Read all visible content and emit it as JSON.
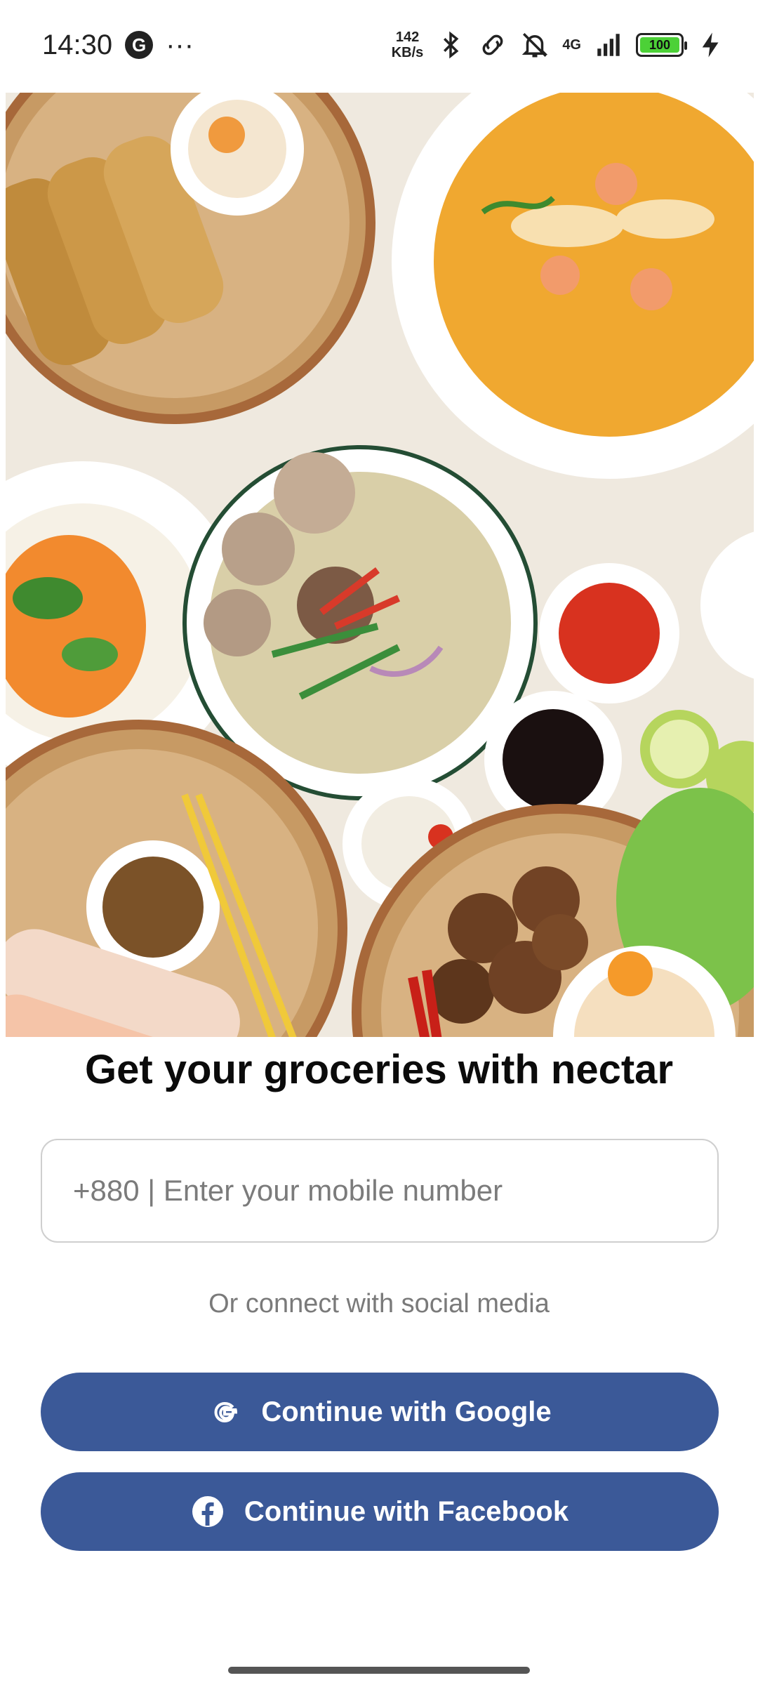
{
  "status_bar": {
    "time": "14:30",
    "g_icon": "G",
    "more": "···",
    "speed_value": "142",
    "speed_unit": "KB/s",
    "network": "4G",
    "battery": "100"
  },
  "hero": {
    "image": "vietnamese-food-spread"
  },
  "headline": "Get your groceries with nectar",
  "phone_input": {
    "placeholder": "+880 | Enter your mobile number",
    "value": ""
  },
  "social_caption": "Or connect with social media",
  "buttons": {
    "google_label": "Continue with Google",
    "facebook_label": "Continue with Facebook"
  },
  "colors": {
    "button_bg": "#3b5998",
    "battery_fill": "#4cd137"
  }
}
